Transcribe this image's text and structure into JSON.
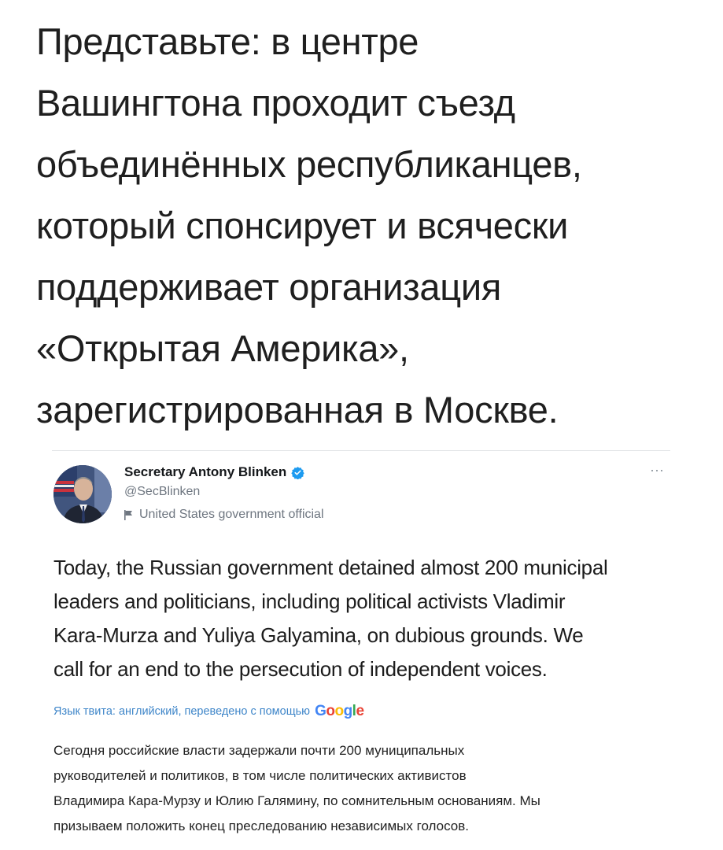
{
  "headline": {
    "lines": [
      "Представьте: в центре",
      "Вашингтона проходит съезд",
      "объединённых республиканцев,",
      "который спонсирует и всячески",
      "поддерживает организация",
      "«Открытая Америка»,",
      "зарегистрированная в Москве."
    ]
  },
  "tweet": {
    "author_name": "Secretary Antony Blinken",
    "handle": "@SecBlinken",
    "government_label": "United States government official",
    "more_label": "···",
    "text_lines": [
      "Today, the Russian government detained almost 200 municipal",
      "leaders and politicians, including political activists Vladimir",
      "Kara-Murza and Yuliya Galyamina, on dubious grounds. We",
      "call for an end to the persecution of independent voices."
    ],
    "translate_note": "Язык твита: английский, переведено с помощью",
    "translate_brand": "Google",
    "translation_lines": [
      "Сегодня российские власти задержали почти 200 муниципальных",
      "руководителей и политиков, в том числе политических активистов",
      "Владимира Кара-Мурзу и Юлию Галямину, по сомнительным основаниям. Мы",
      "призываем положить конец преследованию независимых голосов."
    ]
  },
  "colors": {
    "verified_blue": "#1d9bf0",
    "link_blue": "#3f86c9",
    "muted_gray": "#6e7680"
  },
  "icons": {
    "verified": "verified-badge-icon",
    "flag": "flag-icon",
    "more": "more-dots-icon"
  }
}
